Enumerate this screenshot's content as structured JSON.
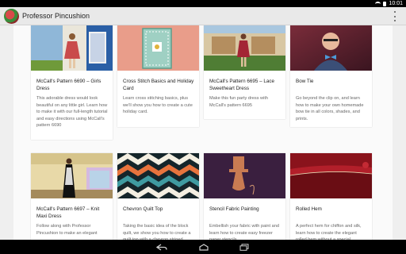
{
  "status": {
    "time": "10:01"
  },
  "app": {
    "title": "Professor Pincushion"
  },
  "cards": [
    {
      "title": "McCall's Pattern 6690 – Girls Dress",
      "desc": "This adorable dress would look beautiful on any little girl. Learn how to make it with our full-length tutorial and easy directions using McCall's pattern 6690"
    },
    {
      "title": "Cross Stitch Basics and Holiday Card",
      "desc": "Learn cross stitching basics, plus we'll show you how to create a cute holiday card."
    },
    {
      "title": "McCall's Pattern 6695 – Lace Sweetheart Dress",
      "desc": "Make this fun party dress with McCall's pattern 6695"
    },
    {
      "title": "Bow Tie",
      "desc": "Go beyond the clip on, and learn how to make your own homemade bow tie in all colors, shades, and prints."
    },
    {
      "title": "McCall's Pattern 6697 – Knit Maxi Dress",
      "desc": "Follow along with Professor Pincushion to make an elegant"
    },
    {
      "title": "Chevron Quilt Top",
      "desc": "Taking the basic idea of the block quilt, we show you how to create a quilt top with a chevron striped"
    },
    {
      "title": "Stencil Fabric Painting",
      "desc": "Embellish your fabric with paint and learn how to create easy freezer paper stencils."
    },
    {
      "title": "Rolled Hem",
      "desc": "A perfect hem for chiffon and silk, learn how to create the elegant rolled hem without a special"
    }
  ]
}
